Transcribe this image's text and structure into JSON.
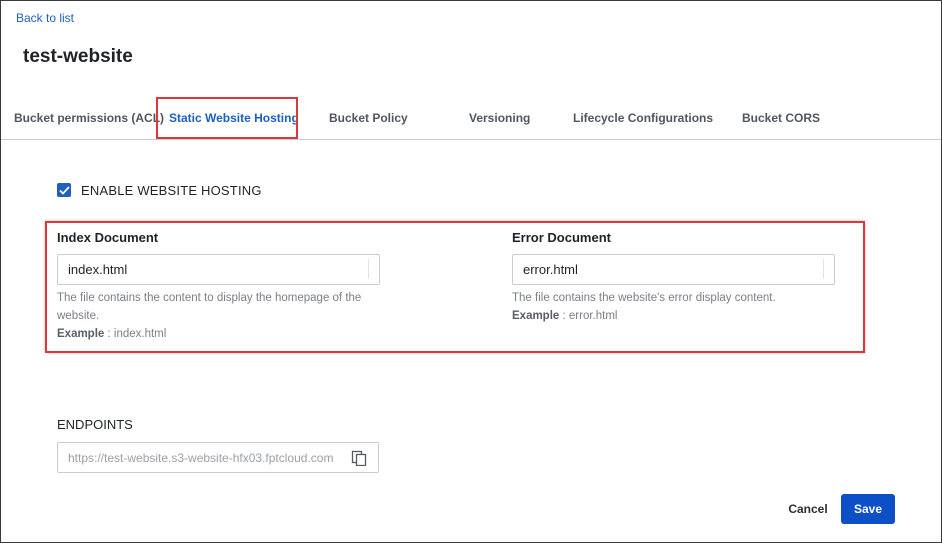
{
  "nav": {
    "back_label": "Back to list"
  },
  "page": {
    "title": "test-website"
  },
  "tabs": [
    {
      "label": "Bucket permissions (ACL)",
      "active": false
    },
    {
      "label": "Static Website Hosting",
      "active": true
    },
    {
      "label": "Bucket Policy",
      "active": false
    },
    {
      "label": "Versioning",
      "active": false
    },
    {
      "label": "Lifecycle Configurations",
      "active": false
    },
    {
      "label": "Bucket CORS",
      "active": false
    }
  ],
  "hosting": {
    "enable_label": "ENABLE WEBSITE HOSTING",
    "enabled": true
  },
  "index_doc": {
    "label": "Index Document",
    "value": "index.html",
    "help": "The file contains the content to display the homepage of the website.",
    "example_label": "Example",
    "example_value": " : index.html"
  },
  "error_doc": {
    "label": "Error Document",
    "value": "error.html",
    "help": "The file contains the website's error display content.",
    "example_label": "Example",
    "example_value": " : error.html"
  },
  "endpoints": {
    "label": "ENDPOINTS",
    "url": "https://test-website.s3-website-hfx03.fptcloud.com"
  },
  "actions": {
    "cancel_label": "Cancel",
    "save_label": "Save"
  },
  "colors": {
    "accent": "#1f5fbf",
    "primary_button": "#0d4fc7",
    "highlight": "#e0363b"
  }
}
